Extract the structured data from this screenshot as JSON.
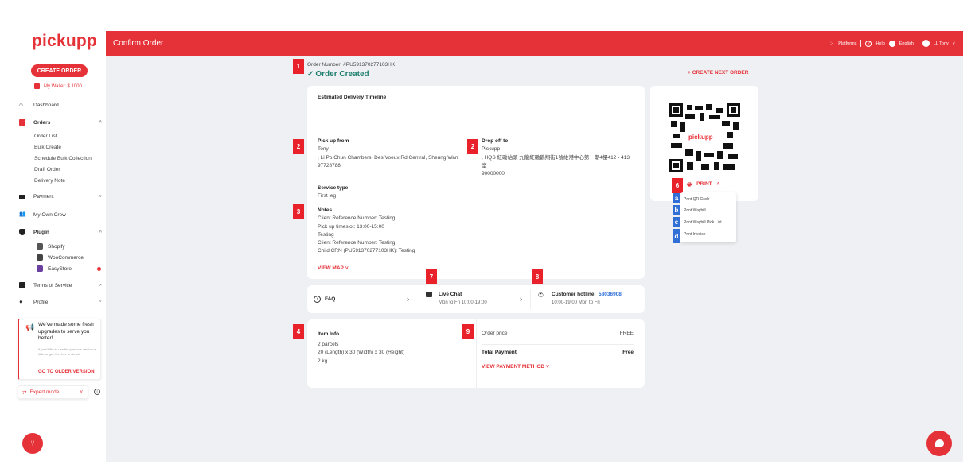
{
  "app": {
    "logo": "pickupp",
    "page_title": "Confirm Order"
  },
  "header": {
    "platforms": "Platforms",
    "help": "Help",
    "language": "English",
    "user": "LL Tony"
  },
  "sidebar": {
    "create_order": "CREATE ORDER",
    "wallet": "My Wallet: $ 1000",
    "dashboard": "Dashboard",
    "orders": "Orders",
    "order_subitems": [
      "Order List",
      "Bulk Create",
      "Schedule Bulk Collection",
      "Draft Order",
      "Delivery Note"
    ],
    "payment": "Payment",
    "my_own_crew": "My Own Crew",
    "plugin": "Plugin",
    "plugins": [
      "Shopify",
      "WooCommerce",
      "EasyStore"
    ],
    "terms": "Terms of Service",
    "profile": "Profile",
    "promo_title": "We've made some fresh upgrades to serve you better!",
    "promo_body": "If you'd like to use the previous version a little longer, feel free to do so!",
    "promo_link": "GO TO OLDER VERSION",
    "expert_mode": "Expert mode"
  },
  "order": {
    "number": "Order Number: #PU591370277103HK",
    "status": "Order Created",
    "create_next": "CREATE NEXT ORDER",
    "timeline_title": "Estimated Delivery Timeline",
    "pickup_label": "Pick up from",
    "pickup_name": "Tony",
    "pickup_address": ", Li Po Chun Chambers, Des Voeux Rd Central, Sheung Wan",
    "pickup_phone": "97728788",
    "dropoff_label": "Drop off to",
    "dropoff_name": "Pickupp",
    "dropoff_address": ", HQS 紅磡站頭 九龍紅磡鶴翔街1號維港中心第一期4樓412 - 413室",
    "dropoff_phone": "90000000",
    "service_label": "Service type",
    "service_value": "First leg",
    "notes_label": "Notes",
    "notes": [
      "Client Reference Number: Testing",
      "Pick up timeslot: 13:00-15:00",
      "Testing",
      "Client Reference Number: Testing",
      "Child CRN (PU591370277103HK): Testing"
    ],
    "view_map": "VIEW MAP"
  },
  "support": {
    "faq": "FAQ",
    "live_chat": "Live Chat",
    "live_chat_hours": "Mon to Fri 10:00-19:00",
    "hotline_label": "Customer hotline:",
    "hotline_number": "58036908",
    "hotline_hours": "10:00-19:00 Mon to Fri"
  },
  "items": {
    "label": "Item Info",
    "parcels": "2 parcels",
    "dimensions": "20 (Length) x 30 (Width) x 30 (Height)",
    "weight": "2 kg"
  },
  "payment": {
    "order_price_label": "Order price",
    "order_price": "FREE",
    "total_label": "Total Payment",
    "total": "Free",
    "view_method": "VIEW PAYMENT METHOD"
  },
  "print": {
    "label": "PRINT",
    "options": [
      "Print QR Code",
      "Print Waybill",
      "Print Waybill Pick List",
      "Print Invoice"
    ],
    "qr_text": "pickupp"
  },
  "annotations": {
    "badges": [
      "1",
      "2",
      "2",
      "3",
      "4",
      "6",
      "7",
      "8",
      "9"
    ],
    "letters": [
      "a",
      "b",
      "c",
      "d"
    ]
  },
  "colors": {
    "brand": "#e53238",
    "status_green": "#1e7f6e",
    "annotation_red": "#e8212a",
    "annotation_blue": "#2f6fd6"
  }
}
